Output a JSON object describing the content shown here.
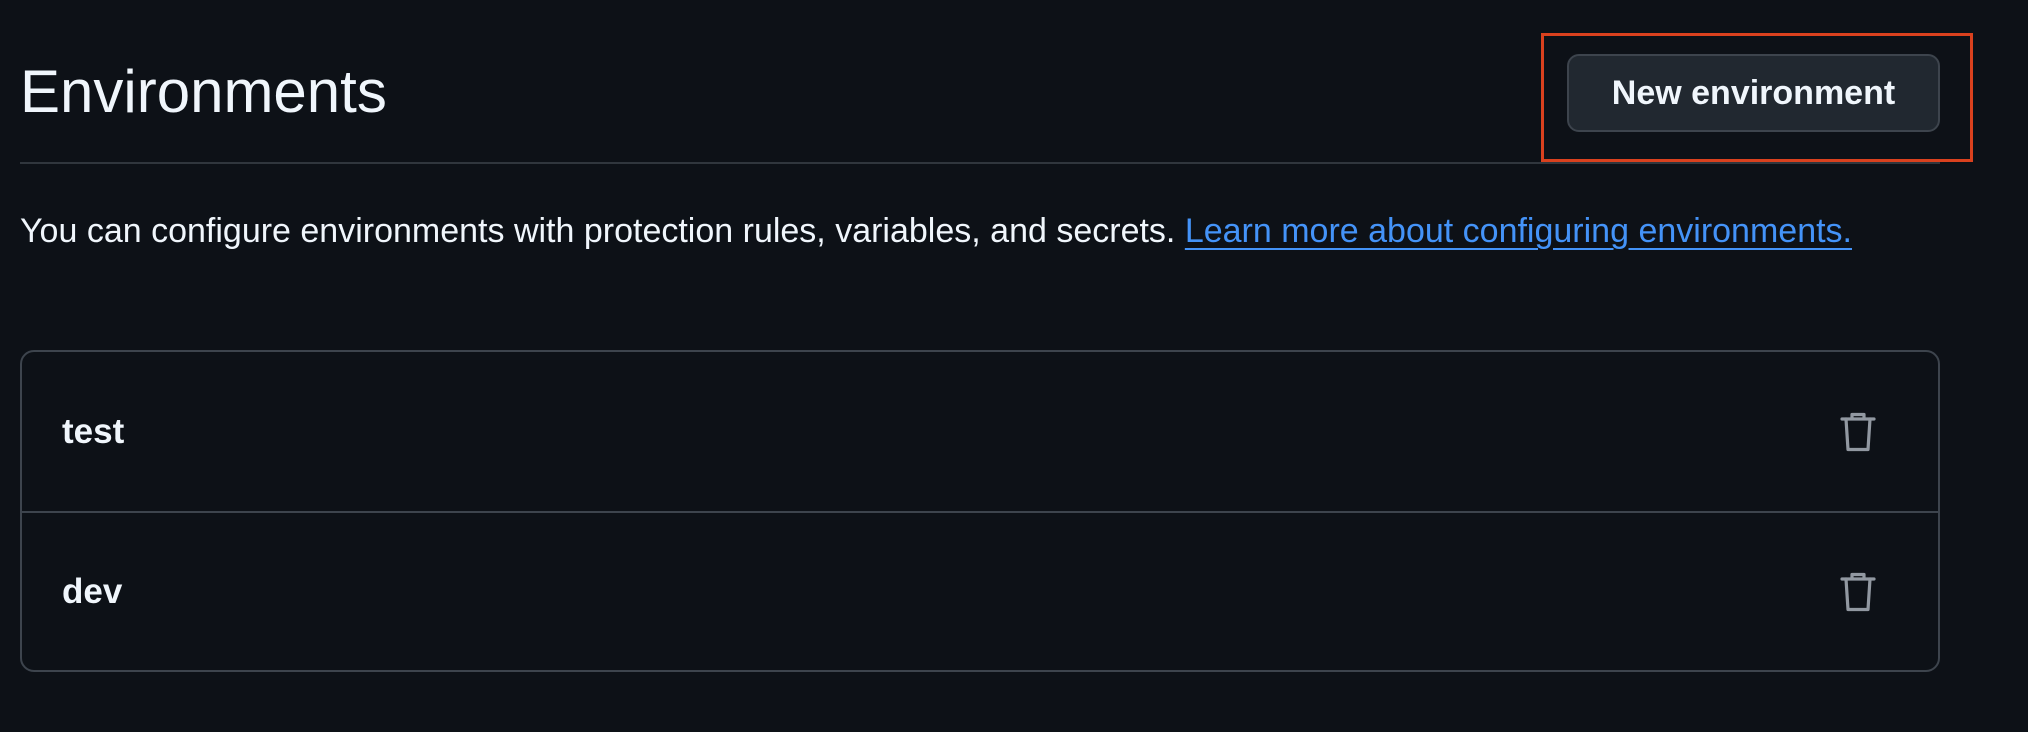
{
  "header": {
    "title": "Environments",
    "new_environment_label": "New environment"
  },
  "description": {
    "text": "You can configure environments with protection rules, variables, and secrets. ",
    "link_text": "Learn more about configuring environments."
  },
  "environments": [
    {
      "name": "test",
      "action_icon": "trash-icon"
    },
    {
      "name": "dev",
      "action_icon": "trash-icon"
    }
  ],
  "colors": {
    "background": "#0d1117",
    "text": "#f0f6fc",
    "link": "#4493f8",
    "border": "#3d444d",
    "button_bg": "#212830",
    "highlight": "#d9411e",
    "icon": "#9198a1"
  }
}
